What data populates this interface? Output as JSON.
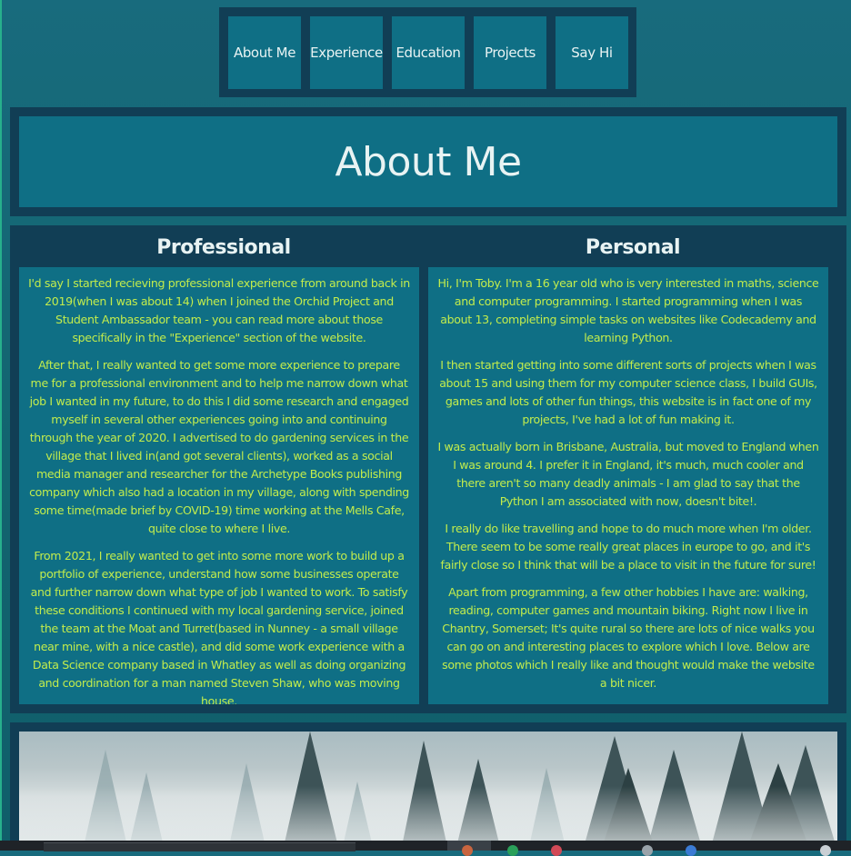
{
  "nav": {
    "items": [
      "About Me",
      "Experience",
      "Education",
      "Projects",
      "Say Hi"
    ]
  },
  "page_title": "About Me",
  "professional": {
    "heading": "Professional",
    "paragraphs": [
      "I'd say I started recieving professional experience from around back in 2019(when I was about 14) when I joined the Orchid Project and Student Ambassador team - you can read more about those specifically in the \"Experience\" section of the website.",
      "After that, I really wanted to get some more experience to prepare me for a professional environment and to help me narrow down what job I wanted in my future, to do this I did some research and engaged myself in several other experiences going into and continuing through the year of 2020. I advertised to do gardening services in the village that I lived in(and got several clients), worked as a social media manager and researcher for the Archetype Books publishing company which also had a location in my village, along with spending some time(made brief by COVID-19) time working at the Mells Cafe, quite close to where I live.",
      "From 2021, I really wanted to get into some more work to build up a portfolio of experience, understand how some businesses operate and further narrow down what type of job I wanted to work. To satisfy these conditions I continued with my local gardening service, joined the team at the Moat and Turret(based in Nunney - a small village near mine, with a nice castle), and did some work experience with a Data Science company based in Whatley as well as doing organizing and coordination for a man named Steven Shaw, who was moving house."
    ]
  },
  "personal": {
    "heading": "Personal",
    "paragraphs": [
      "Hi, I'm Toby. I'm a 16 year old who is very interested in maths, science and computer programming. I started programming when I was about 13, completing simple tasks on websites like Codecademy and learning Python.",
      "I then started getting into some different sorts of projects when I was about 15 and using them for my computer science class, I build GUIs, games and lots of other fun things, this website is in fact one of my projects, I've had a lot of fun making it.",
      "I was actually born in Brisbane, Australia, but moved to England when I was around 4. I prefer it in England, it's much, much cooler and there aren't so many deadly animals - I am glad to say that the Python I am associated with now, doesn't bite!.",
      "I really do like travelling and hope to do much more when I'm older. There seem to be some really great places in europe to go, and it's fairly close so I think that will be a place to visit in the future for sure!",
      "Apart from programming, a few other hobbies I have are: walking, reading, computer games and mountain biking. Right now I live in Chantry, Somerset; It's quite rural so there are lots of nice walks you can go on and interesting places to explore which I love. Below are some photos which I really like and thought would make the website a bit nicer."
    ]
  },
  "photo": {
    "subject": "misty pine forest"
  },
  "colors": {
    "panel": "#113e55",
    "box": "#0f6f85",
    "body_text": "#c2ec4c",
    "heading_text": "#e8f3f3"
  }
}
